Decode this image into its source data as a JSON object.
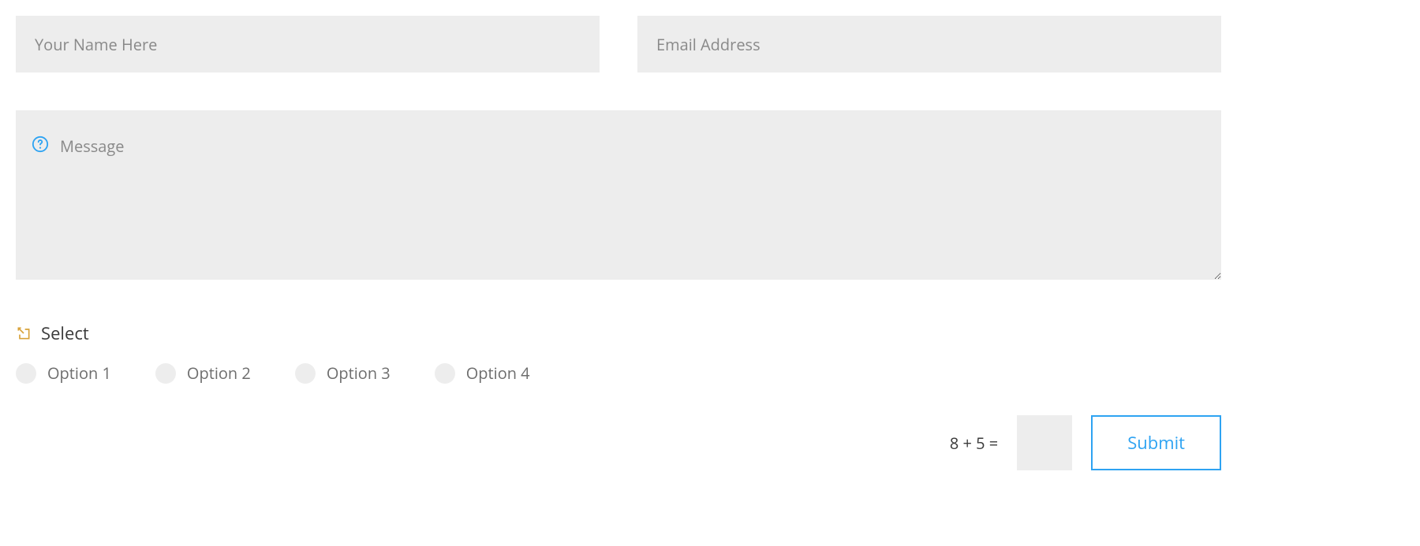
{
  "form": {
    "name": {
      "placeholder": "Your Name Here",
      "value": ""
    },
    "email": {
      "placeholder": "Email Address",
      "value": ""
    },
    "message": {
      "placeholder": "Message",
      "value": ""
    },
    "select": {
      "label": "Select",
      "options": [
        "Option 1",
        "Option 2",
        "Option 3",
        "Option 4"
      ]
    },
    "captcha": {
      "question": "8 + 5 =",
      "value": ""
    },
    "submit_label": "Submit"
  },
  "icons": {
    "help": "help-circle",
    "select": "arrow-into-box"
  },
  "colors": {
    "input_bg": "#ededed",
    "accent": "#2ea3f2",
    "select_icon": "#d8a23a",
    "help_icon": "#2ea3f2"
  }
}
